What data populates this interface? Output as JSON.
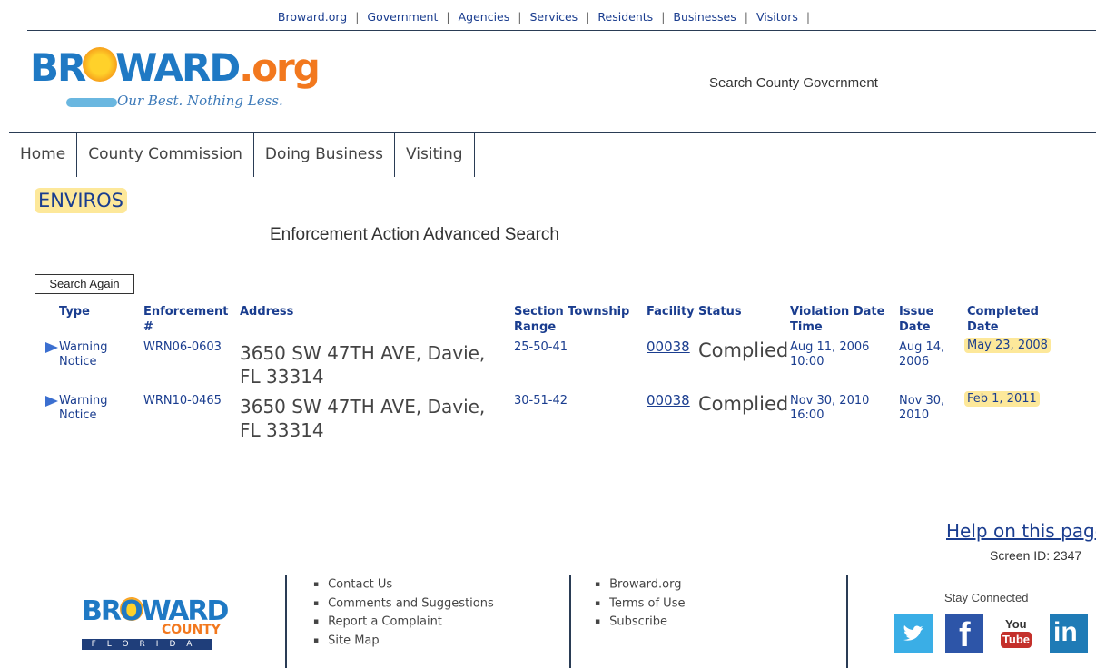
{
  "topnav": {
    "items": [
      "Broward.org",
      "Government",
      "Agencies",
      "Services",
      "Residents",
      "Businesses",
      "Visitors"
    ],
    "trailing_sep": "|"
  },
  "header": {
    "logo_text_left": "BR",
    "logo_text_mid": "WARD",
    "logo_text_right": ".org",
    "logo_tagline": "Our Best. Nothing Less.",
    "search_label": "Search County Government"
  },
  "mainnav": [
    "Home",
    "County Commission",
    "Doing Business",
    "Visiting"
  ],
  "page": {
    "app_name": "ENVIROS",
    "title": "Enforcement Action Advanced Search",
    "search_again": "Search Again"
  },
  "table": {
    "headers": {
      "type": "Type",
      "enf": "Enforcement #",
      "address": "Address",
      "str": "Section Township Range",
      "facility": "Facility",
      "status": "Status",
      "viol": "Violation Date Time",
      "issue": "Issue Date",
      "completed": "Completed Date"
    },
    "rows": [
      {
        "type": "Warning Notice",
        "enf": "WRN06-0603",
        "address": "3650 SW 47TH AVE, Davie, FL 33314",
        "str": "25-50-41",
        "facility": "00038",
        "status": "Complied",
        "viol": "Aug 11, 2006 10:00",
        "issue": "Aug 14, 2006",
        "completed": "May 23, 2008"
      },
      {
        "type": "Warning Notice",
        "enf": "WRN10-0465",
        "address": "3650 SW 47TH AVE, Davie, FL 33314",
        "str": "30-51-42",
        "facility": "00038",
        "status": "Complied",
        "viol": "Nov 30, 2010 16:00",
        "issue": "Nov 30, 2010",
        "completed": "Feb 1, 2011"
      }
    ]
  },
  "help": {
    "link": "Help on this page",
    "screen_id": "Screen ID: 2347"
  },
  "footer": {
    "logo_word": "BROWARD",
    "logo_county": "COUNTY",
    "logo_state": "FLORIDA",
    "col1": [
      "Contact Us",
      "Comments and Suggestions",
      "Report a Complaint",
      "Site Map"
    ],
    "col2": [
      "Broward.org",
      "Terms of Use",
      "Subscribe"
    ],
    "stay_connected": "Stay Connected",
    "social": [
      "twitter-icon",
      "facebook-icon",
      "youtube-icon",
      "linkedin-icon"
    ],
    "youtube_you": "You",
    "youtube_tube": "Tube"
  },
  "colors": {
    "link_blue": "#1a3d8f",
    "highlight": "#fde89a",
    "rule": "#2a3c55"
  }
}
